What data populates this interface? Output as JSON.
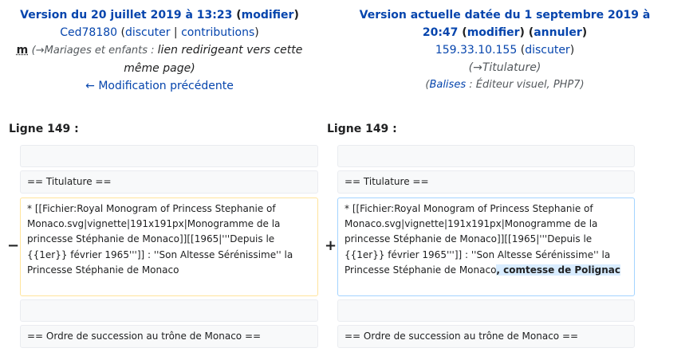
{
  "left": {
    "title_prefix": "Version du 20 juillet 2019 à 13:23",
    "edit_link": "modifier",
    "user": "Ced78180",
    "talk_link": "discuter",
    "contribs_link": "contributions",
    "minor_flag": "m",
    "summary_section": "(→Mariages et enfants : ",
    "summary_text": "lien redirigeant vers cette même page)",
    "prev_link": "← Modification précédente"
  },
  "right": {
    "title_line1": "Version actuelle datée du 1 septembre 2019 à",
    "title_line2": "20:47",
    "edit_link": "modifier",
    "undo_link": "annuler",
    "user": "159.33.10.155",
    "talk_link": "discuter",
    "summary": "(→Titulature)",
    "tags_prefix": "(",
    "tags_link": "Balises",
    "tags_text": " : Éditeur visuel, PHP7)"
  },
  "diff": {
    "left_line_header": "Ligne 149 :",
    "right_line_header": "Ligne 149 :",
    "context_titulature": "== Titulature ==",
    "removed_text": "* [[Fichier:Royal Monogram of Princess Stephanie of Monaco.svg|vignette|191x191px|Monogramme de la princesse Stéphanie de Monaco]][[1965|'''Depuis le {{1er}} février 1965''']] : ''Son Altesse Sérénissime'' la Princesse Stéphanie de Monaco",
    "added_text_base": "* [[Fichier:Royal Monogram of Princess Stephanie of Monaco.svg|vignette|191x191px|Monogramme de la princesse Stéphanie de Monaco]][[1965|'''Depuis le {{1er}} février 1965''']] : ''Son Altesse Sérénissime'' la Princesse Stéphanie de Monaco",
    "added_text_highlight": ", comtesse de Polignac",
    "context_succession": "== Ordre de succession au trône de Monaco ==",
    "minus_marker": "−",
    "plus_marker": "+"
  }
}
